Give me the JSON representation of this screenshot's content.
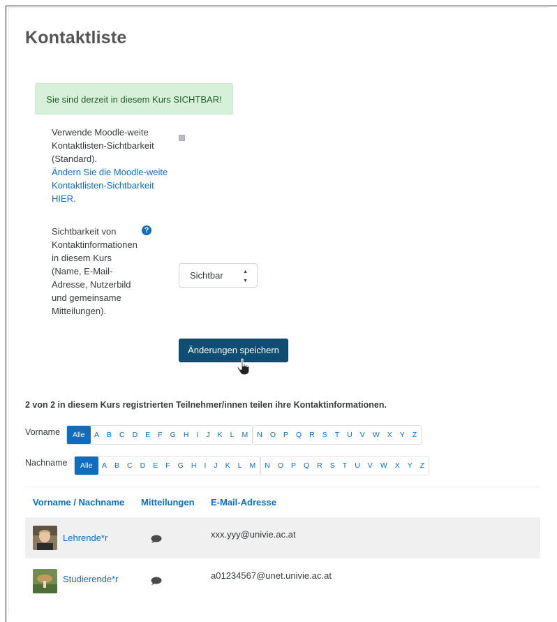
{
  "page": {
    "title": "Kontaktliste",
    "alert": "Sie sind derzeit in diesem Kurs SICHTBAR!"
  },
  "settings": {
    "moodle_wide_label": "Verwende Moodle-weite Kontaktlisten-Sichtbarkeit (Standard).",
    "moodle_wide_link": "Ändern Sie die Moodle-weite Kontaktlisten-Sichtbarkeit HIER.",
    "moodle_wide_checked": false,
    "visibility_label": "Sichtbarkeit von Kontaktinformationen in diesem Kurs (Name, E-Mail-Adresse, Nutzerbild und gemeinsame Mitteilungen).",
    "visibility_value": "Sichtbar",
    "help_icon": "question-circle-icon",
    "save_label": "Änderungen speichern"
  },
  "summary": "2 von 2 in diesem Kurs registrierten Teilnehmer/innen teilen ihre Kontaktinformationen.",
  "filters": {
    "all_label": "Alle",
    "firstname_label": "Vorname",
    "lastname_label": "Nachname",
    "letters_first": [
      "A",
      "B",
      "C",
      "D",
      "E",
      "F",
      "G",
      "H",
      "I",
      "J",
      "K",
      "L",
      "M"
    ],
    "letters_second": [
      "N",
      "O",
      "P",
      "Q",
      "R",
      "S",
      "T",
      "U",
      "V",
      "W",
      "X",
      "Y",
      "Z"
    ]
  },
  "table": {
    "headers": {
      "name": "Vorname / Nachname",
      "messages": "Mitteilungen",
      "email": "E-Mail-Adresse"
    },
    "rows": [
      {
        "name": "Lehrende*r",
        "email": "xxx.yyy@univie.ac.at",
        "avatar": "teacher-avatar",
        "message_icon": "speech-bubble-icon"
      },
      {
        "name": "Studierende*r",
        "email": "a01234567@unet.univie.ac.at",
        "avatar": "student-avatar",
        "message_icon": "speech-bubble-icon"
      }
    ]
  },
  "colors": {
    "primary": "#0f6cbf",
    "save_button": "#0f4d73",
    "alert_bg": "#d7f0d9"
  }
}
